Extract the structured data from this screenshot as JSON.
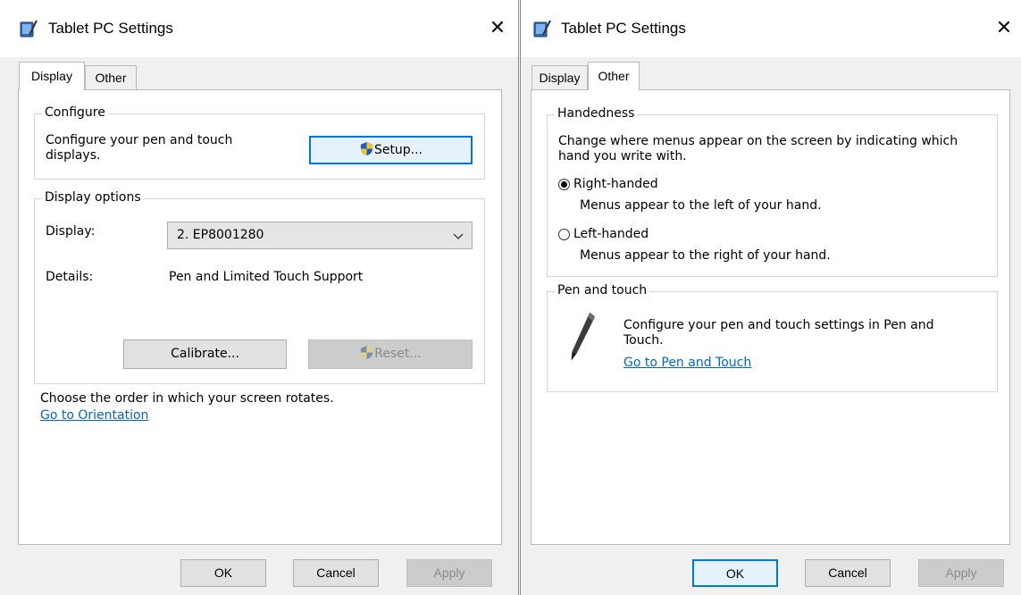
{
  "left": {
    "title": "Tablet PC Settings",
    "close_glyph": "✕",
    "tabs": {
      "display": "Display",
      "other": "Other"
    },
    "configure": {
      "group_label": "Configure",
      "desc_line1": "Configure your pen and touch",
      "desc_line2": "displays.",
      "setup_label": "Setup..."
    },
    "display_options": {
      "group_label": "Display options",
      "display_label": "Display:",
      "display_value": "2. EP8001280",
      "details_label": "Details:",
      "details_value": "Pen and Limited Touch Support",
      "calibrate_label": "Calibrate...",
      "reset_label": "Reset..."
    },
    "orientation": {
      "text": "Choose the order in which your screen rotates.",
      "link": "Go to Orientation"
    },
    "footer": {
      "ok": "OK",
      "cancel": "Cancel",
      "apply": "Apply"
    }
  },
  "right": {
    "title": "Tablet PC Settings",
    "close_glyph": "✕",
    "tabs": {
      "display": "Display",
      "other": "Other"
    },
    "handedness": {
      "group_label": "Handedness",
      "desc_line1": "Change where menus appear on the screen by indicating which",
      "desc_line2": "hand you write with.",
      "right_label": "Right-handed",
      "right_desc": "Menus appear to the left of your hand.",
      "left_label": "Left-handed",
      "left_desc": "Menus appear to the right of your hand.",
      "selected": "right"
    },
    "pen_touch": {
      "group_label": "Pen and touch",
      "desc_line1": "Configure your pen and touch settings in Pen and",
      "desc_line2": "Touch.",
      "link": "Go to Pen and Touch"
    },
    "footer": {
      "ok": "OK",
      "cancel": "Cancel",
      "apply": "Apply"
    }
  },
  "icons": {
    "app": "tablet-pc-icon",
    "shield": "uac-shield-icon",
    "pen": "pen-icon",
    "close": "close-icon",
    "chevron": "chevron-down-icon"
  },
  "colors": {
    "accent": "#0078d7",
    "link": "#0066cc",
    "dialog_bg": "#f0f0f0",
    "panel_bg": "#ffffff"
  }
}
